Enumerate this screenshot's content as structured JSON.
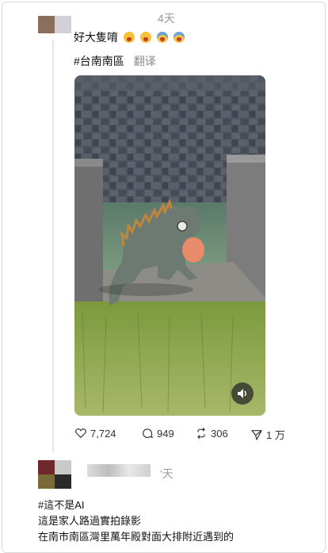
{
  "post": {
    "time": "4天",
    "text": "好大隻唷",
    "emoji_count": 4,
    "tags": "#台南南區",
    "translate_label": "翻译"
  },
  "actions": {
    "likes": "7,724",
    "comments": "949",
    "reposts": "306",
    "shares": "1 万"
  },
  "reply": {
    "time": "'天",
    "lines": [
      "#這不是AI",
      "這是家人路過實拍錄影",
      "在南市南區灣里萬年殿對面大排附近遇到的"
    ]
  },
  "icons": {
    "like": "heart-icon",
    "comment": "comment-icon",
    "repost": "repost-icon",
    "share": "send-icon",
    "sound": "speaker-icon"
  }
}
